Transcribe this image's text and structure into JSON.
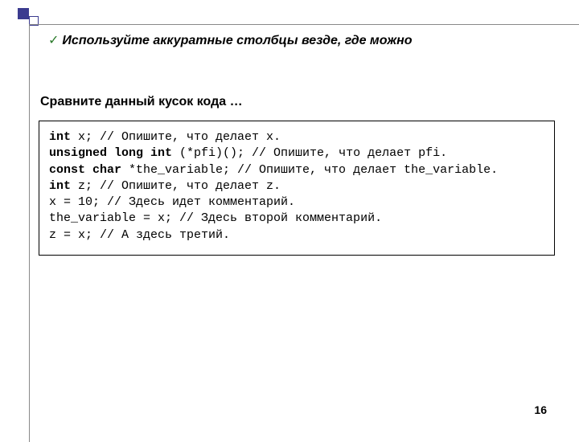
{
  "title": "Используйте аккуратные столбцы везде, где можно",
  "subtitle": "Сравните данный кусок кода …",
  "code": {
    "l1a": "int",
    "l1b": " x; // Опишите, что делает x.",
    "l2a": "unsigned long int",
    "l2b": " (*pfi)(); // Опишите, что делает pfi.",
    "l3a": "const char",
    "l3b": " *the_variable; // Опишите, что делает the_variable.",
    "l4a": "int",
    "l4b": " z; // Опишите, что делает z.",
    "l5": "x = 10; // Здесь идет комментарий.",
    "l6": "the_variable = x; // Здесь второй комментарий.",
    "l7": "z = x; // А здесь третий."
  },
  "page_number": "16",
  "checkmark": "✓"
}
